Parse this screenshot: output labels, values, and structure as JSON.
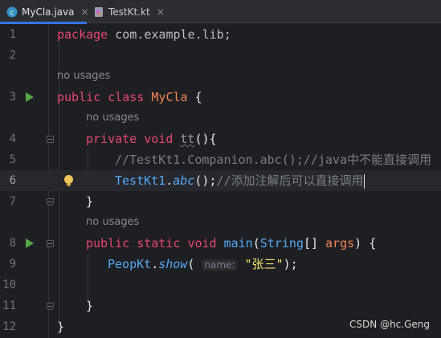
{
  "tabs": [
    {
      "label": "MyCla.java",
      "icon": "java-class-icon",
      "active": true,
      "close": "×"
    },
    {
      "label": "TestKt.kt",
      "icon": "kotlin-file-icon",
      "active": false,
      "close": "×"
    }
  ],
  "editor": {
    "usage_hints": [
      "no usages",
      "no usages",
      "no usages"
    ],
    "lines": [
      {
        "n": "1",
        "kw": "package",
        "rest": "com.example.lib;"
      },
      {
        "n": "2"
      },
      {
        "n": "3",
        "kw1": "public",
        "kw2": "class",
        "cls": "MyCla",
        "rest": "{"
      },
      {
        "n": "4",
        "kw1": "private",
        "kw2": "void",
        "fn": "tt",
        "rest": "(){"
      },
      {
        "n": "5",
        "comment": "//TestKt1.Companion.abc();//java中不能直接调用"
      },
      {
        "n": "6",
        "obj": "TestKt1",
        "dot": ".",
        "method": "abc",
        "call": "();",
        "comment": "//添加注解后可以直接调用"
      },
      {
        "n": "7",
        "brace": "}"
      },
      {
        "n": "8",
        "kw1": "public",
        "kw2": "static",
        "kw3": "void",
        "fn": "main",
        "open": "(",
        "type": "String",
        "arr": "[]",
        "param": "args",
        "close": ") {"
      },
      {
        "n": "9",
        "obj": "PeopKt",
        "dot": ".",
        "method": "show",
        "open": "(",
        "hint": "name:",
        "str": "\"张三\"",
        "close": ");"
      },
      {
        "n": "10"
      },
      {
        "n": "11",
        "brace": "}"
      },
      {
        "n": "12",
        "brace": "}"
      }
    ]
  },
  "watermark": "CSDN @hc.Geng",
  "colors": {
    "keyword": "#e5467b",
    "class": "#ef8654",
    "function": "#56a8f5",
    "comment": "#7a7e85",
    "string": "#f2e26f",
    "run": "#57a64a"
  }
}
